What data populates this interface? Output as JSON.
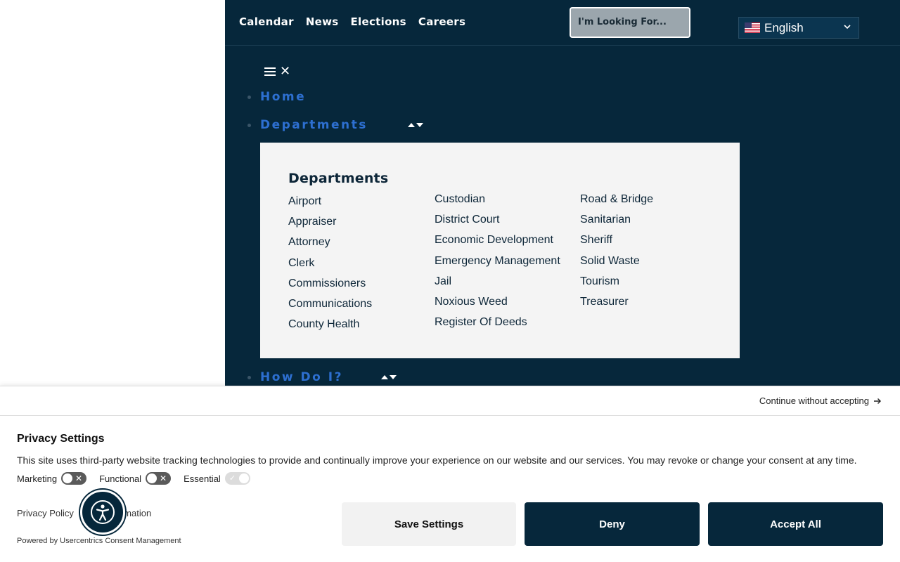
{
  "topnav": {
    "links": [
      "Calendar",
      "News",
      "Elections",
      "Careers"
    ]
  },
  "search": {
    "placeholder": "I'm Looking For..."
  },
  "language": {
    "selected": "English"
  },
  "menu": {
    "items": [
      {
        "label": "Home"
      },
      {
        "label": "Departments"
      },
      {
        "label": "How Do I?"
      }
    ]
  },
  "departments": {
    "title": "Departments",
    "col1": [
      "Airport",
      "Appraiser",
      "Attorney",
      "Clerk",
      "Commissioners",
      "Communications",
      "County Health"
    ],
    "col2": [
      "Custodian",
      "District Court",
      "Economic Development",
      "Emergency Management",
      "Jail",
      "Noxious Weed",
      "Register Of Deeds"
    ],
    "col3": [
      "Road & Bridge",
      "Sanitarian",
      "Sheriff",
      "Solid Waste",
      "Tourism",
      "Treasurer"
    ]
  },
  "consent": {
    "continue_label": "Continue without accepting",
    "title": "Privacy Settings",
    "text": "This site uses third-party website tracking technologies to provide and continually improve your experience on our website and our services. You may revoke or change your consent at any time.",
    "toggles": [
      "Marketing",
      "Functional",
      "Essential"
    ],
    "privacy_policy": "Privacy Policy",
    "more_info": "More Information",
    "powered_by": "Powered by",
    "powered_link": "Usercentrics Consent Management",
    "save_label": "Save Settings",
    "deny_label": "Deny",
    "accept_label": "Accept All"
  },
  "colors": {
    "navy": "#06273b",
    "link_blue": "#2d6fd0",
    "panel_bg": "#f4f4f4"
  }
}
